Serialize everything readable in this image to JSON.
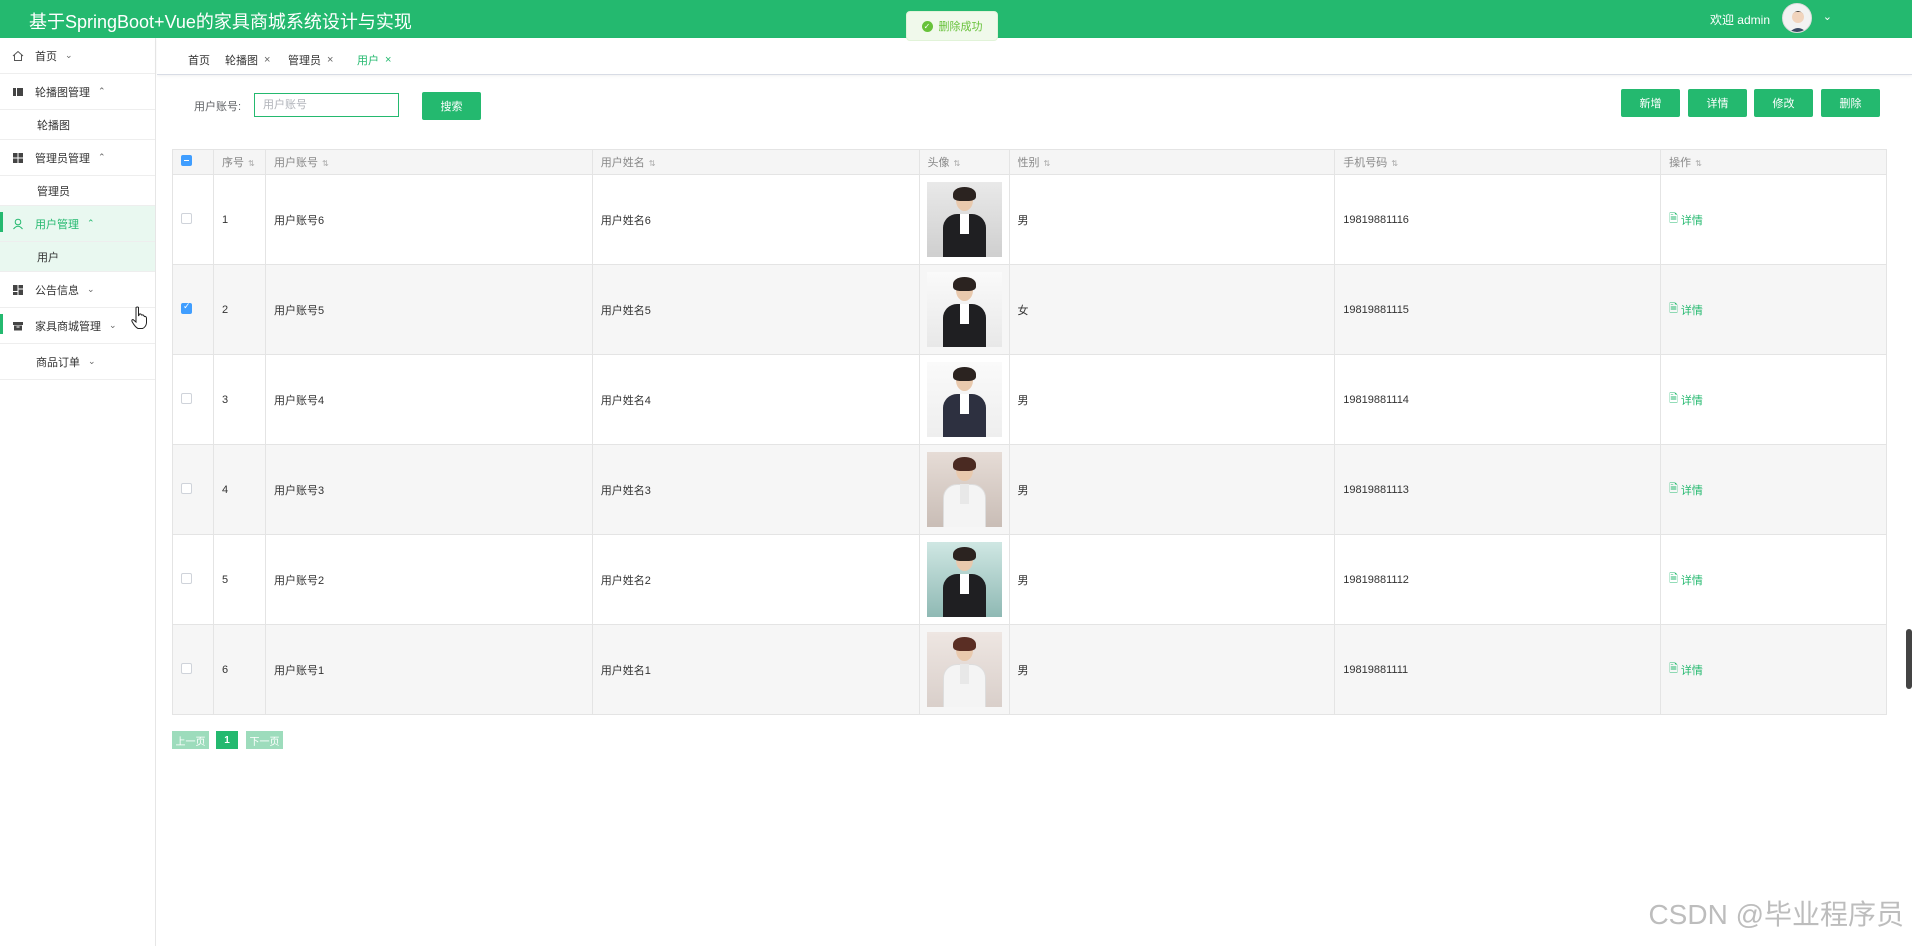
{
  "header": {
    "title": "基于SpringBoot+Vue的家具商城系统设计与实现",
    "welcome": "欢迎 admin",
    "bg_color": "#24b96f"
  },
  "toast": {
    "message": "删除成功"
  },
  "sidebar": {
    "home": "首页",
    "carousel_mgmt": "轮播图管理",
    "carousel": "轮播图",
    "admin_mgmt": "管理员管理",
    "admin": "管理员",
    "user_mgmt": "用户管理",
    "user": "用户",
    "notice": "公告信息",
    "furniture_mgmt": "家具商城管理",
    "orders": "商品订单"
  },
  "tabs": [
    {
      "label": "首页"
    },
    {
      "label": "轮播图"
    },
    {
      "label": "管理员"
    },
    {
      "label": "用户"
    }
  ],
  "search": {
    "label": "用户账号:",
    "placeholder": "用户账号",
    "button": "搜索"
  },
  "actions": {
    "add": "新增",
    "detail": "详情",
    "edit": "修改",
    "delete": "删除"
  },
  "table": {
    "columns": [
      "序号",
      "用户账号",
      "用户姓名",
      "头像",
      "性别",
      "手机号码",
      "操作"
    ],
    "rows": [
      {
        "no": "1",
        "account": "用户账号6",
        "name": "用户姓名6",
        "gender": "男",
        "phone": "19819881116",
        "op": "详情"
      },
      {
        "no": "2",
        "account": "用户账号5",
        "name": "用户姓名5",
        "gender": "女",
        "phone": "19819881115",
        "op": "详情"
      },
      {
        "no": "3",
        "account": "用户账号4",
        "name": "用户姓名4",
        "gender": "男",
        "phone": "19819881114",
        "op": "详情"
      },
      {
        "no": "4",
        "account": "用户账号3",
        "name": "用户姓名3",
        "gender": "男",
        "phone": "19819881113",
        "op": "详情"
      },
      {
        "no": "5",
        "account": "用户账号2",
        "name": "用户姓名2",
        "gender": "男",
        "phone": "19819881112",
        "op": "详情"
      },
      {
        "no": "6",
        "account": "用户账号1",
        "name": "用户姓名1",
        "gender": "男",
        "phone": "19819881111",
        "op": "详情"
      }
    ]
  },
  "pagination": {
    "prev": "上一页",
    "current": "1",
    "next": "下一页"
  },
  "watermark": "CSDN @毕业程序员"
}
